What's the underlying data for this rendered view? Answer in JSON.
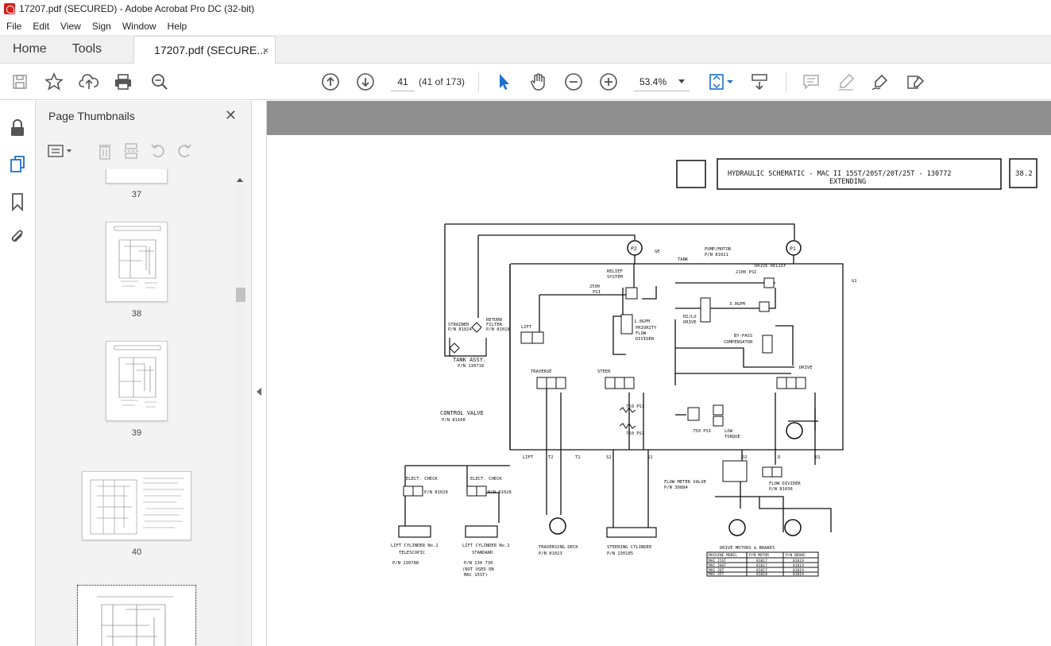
{
  "window": {
    "title": "17207.pdf (SECURED) - Adobe Acrobat Pro DC (32-bit)"
  },
  "menu": [
    "File",
    "Edit",
    "View",
    "Sign",
    "Window",
    "Help"
  ],
  "tabs": {
    "home": "Home",
    "tools": "Tools",
    "document": "17207.pdf (SECURE...",
    "close": "×"
  },
  "toolbar": {
    "page_current": "41",
    "page_count": "(41 of 173)",
    "zoom": "53.4%"
  },
  "thumbnails": {
    "header": "Page Thumbnails",
    "close": "✕",
    "items": [
      {
        "label": "37"
      },
      {
        "label": "38"
      },
      {
        "label": "39"
      },
      {
        "label": "40"
      },
      {
        "label": ""
      }
    ]
  },
  "schematic": {
    "title_line1": "HYDRAULIC SCHEMATIC - MAC II 15ST/20ST/20T/25T - 130772",
    "title_line2": "EXTENDING",
    "page_ref": "38.2",
    "labels": {
      "p2": "P2",
      "p1": "P1",
      "g": "GE",
      "tank": "TANK",
      "pump_motor": "PUMP/MOTOR",
      "pump_pn": "P/N 81021",
      "relief": "RELIEF",
      "system": "SYSTEM",
      "psi2500": "2500",
      "psi": "PSI",
      "drive_relief": "DRIVE RELIEF",
      "psi2100": "2100 PSI",
      "g1": "G1",
      "gpm": "3.0GPM",
      "hilo": "HI/LO",
      "drive": "DRIVE",
      "bypass": "BY-PASS",
      "compensator": "COMPENSATOR",
      "strainer": "STRAINER",
      "strainer_pn": "P/N 81024",
      "return_filter": "RETURN",
      "filter": "FILTER",
      "filter_pn": "P/N 81018",
      "tank_assy": "TANK ASSY.",
      "tank_pn": "P/N 130718",
      "lift": "LIFT",
      "priority": "PRIORITY",
      "flow": "FLOW",
      "divider": "DIVIDER",
      "gpm1": "1.0GPM",
      "traverse": "TRAVERSE",
      "steer": "STEER",
      "drive_top": "DRIVE",
      "control_valve": "CONTROL VALVE",
      "control_pn": "P/N 81108",
      "psi750a": "750 PSI",
      "psi750b": "750 PSI",
      "psi750c": "750 PSI",
      "low_torque": "LOW",
      "torque": "TORQUE",
      "port_lift": "LIFT",
      "port_t2": "T2",
      "port_t1": "T1",
      "port_s2": "S2",
      "port_s1": "S1",
      "port_d2": "D2",
      "port_d": "D",
      "port_d1": "D1",
      "elect_check1": "ELECT. CHECK",
      "elect_check2": "ELECT. CHECK",
      "pn81028a": "P/N 81028",
      "pn81028b": "P/N 81028",
      "flow_meter": "FLOW METER VALVE",
      "flow_meter_pn": "P/N 30884",
      "flow_divider2": "FLOW DIVIDER",
      "flow_divider2_pn": "P/N 81036",
      "lift_cyl1": "LIFT CYLINDER No.1",
      "telescopic": "TELESCOPIC",
      "lift_cyl1_pn": "P/N 130788",
      "lift_cyl2": "LIFT CYLINDER No.2",
      "standard": "STANDARD",
      "lift_cyl2_pn": "P/N 130 730",
      "not_used1": "(NOT USED ON",
      "not_used2": "MAC 15ST)",
      "traversing_deck": "TRAVERSING DECK",
      "traversing_pn": "P/N 81023",
      "steering_cyl": "STEERING CYLINDER",
      "steering_pn": "P/N 130185",
      "drive_motors": "DRIVE MOTORS & BRAKES"
    },
    "table": {
      "headers": [
        "MACHINE MODEL",
        "P/N MOTOR",
        "P/N BRAKE"
      ],
      "rows": [
        [
          "MAC 15ST",
          "81017",
          "81019"
        ],
        [
          "MAC 20ST",
          "81017",
          "81019"
        ],
        [
          "MAC 20T",
          "81017",
          "81019"
        ],
        [
          "MAC 25T",
          "81018",
          "81019"
        ]
      ]
    }
  }
}
